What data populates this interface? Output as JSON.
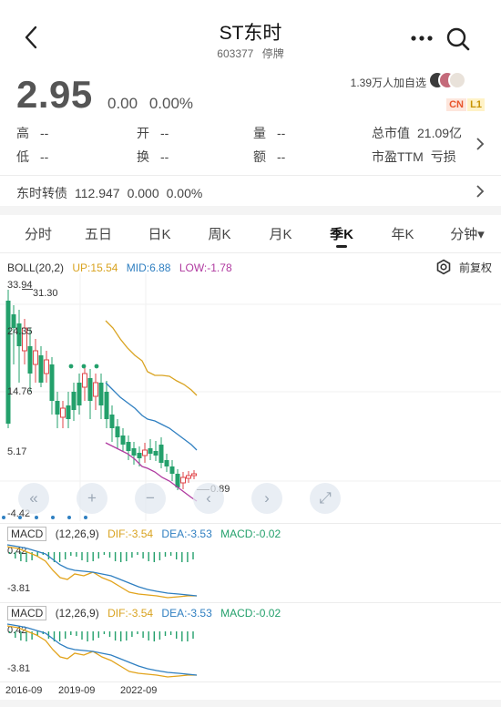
{
  "header": {
    "title": "ST东时",
    "code": "603377",
    "status": "停牌"
  },
  "quote": {
    "price": "2.95",
    "change": "0.00",
    "change_pct": "0.00%",
    "followers": "1.39万人加自选",
    "badge_cn": "CN",
    "badge_l1": "L1"
  },
  "stats": {
    "high_label": "高",
    "high_value": "--",
    "open_label": "开",
    "open_value": "--",
    "volume_label": "量",
    "volume_value": "--",
    "mktcap_label": "总市值",
    "mktcap_value": "21.09亿",
    "low_label": "低",
    "low_value": "--",
    "turnover_label": "换",
    "turnover_value": "--",
    "amount_label": "额",
    "amount_value": "--",
    "pe_label": "市盈TTM",
    "pe_value": "亏损"
  },
  "bond": {
    "name": "东时转债",
    "price": "112.947",
    "change": "0.000",
    "change_pct": "0.00%"
  },
  "tabs": [
    "分时",
    "五日",
    "日K",
    "周K",
    "月K",
    "季K",
    "年K",
    "分钟▾"
  ],
  "active_tab_index": 5,
  "boll": {
    "name": "BOLL(20,2)",
    "up": "UP:15.54",
    "mid": "MID:6.88",
    "low": "LOW:-1.78",
    "adjust": "前复权",
    "y_labels": [
      "33.94",
      "24.35",
      "14.76",
      "5.17",
      "-4.42"
    ],
    "max_marker": "31.30",
    "min_marker": "0.89"
  },
  "macd1": {
    "name": "MACD",
    "params": "(12,26,9)",
    "dif": "DIF:-3.54",
    "dea": "DEA:-3.53",
    "macd": "MACD:-0.02",
    "y_top": "0.42",
    "y_bottom": "-3.81"
  },
  "macd2": {
    "name": "MACD",
    "params": "(12,26,9)",
    "dif": "DIF:-3.54",
    "dea": "DEA:-3.53",
    "macd": "MACD:-0.02",
    "y_top": "0.42",
    "y_bottom": "-3.81"
  },
  "x_labels": [
    "2016-09",
    "2019-09",
    "2022-09"
  ],
  "colors": {
    "up": "#e0464a",
    "down": "#23a06b",
    "boll_up": "#d9a320",
    "boll_mid": "#2f7fc1",
    "boll_low": "#b03aa0",
    "dif": "#e2a31b",
    "dea": "#2f7fc1"
  },
  "icons": [
    "back-arrow-icon",
    "more-icon",
    "search-icon",
    "settings-icon",
    "chevron-right-icon"
  ]
}
